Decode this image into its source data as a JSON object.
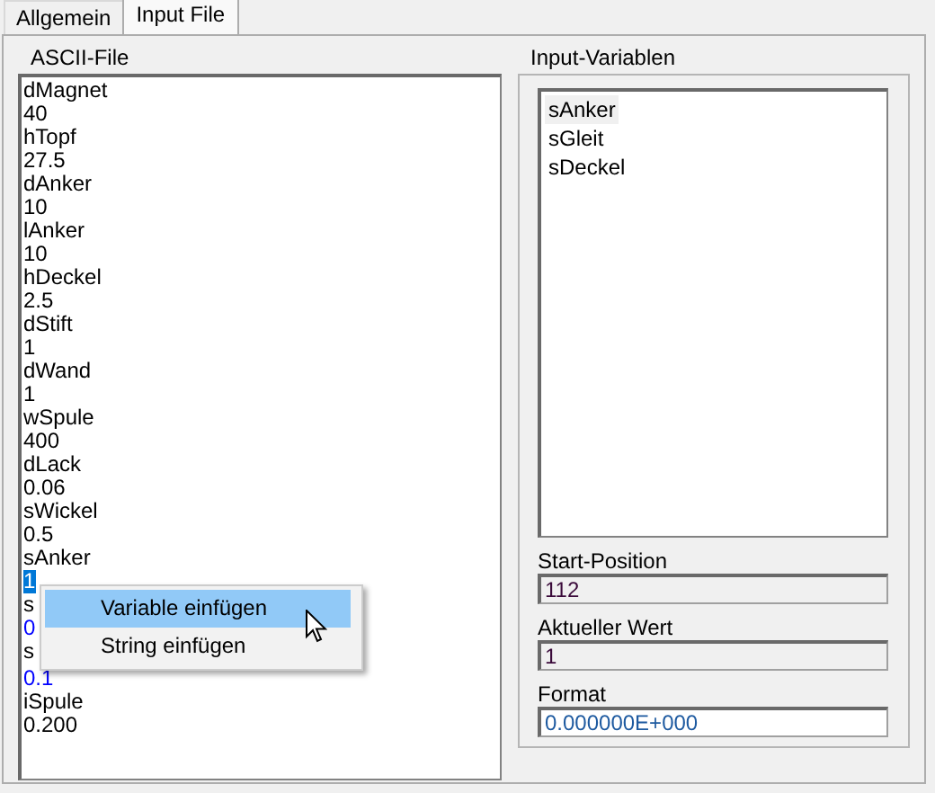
{
  "tabs": [
    {
      "label": "Allgemein",
      "selected": false
    },
    {
      "label": "Input File",
      "selected": true
    }
  ],
  "ascii_file": {
    "label": "ASCII-File",
    "lines": [
      {
        "text": "dMagnet",
        "kind": "plain"
      },
      {
        "text": "40",
        "kind": "plain"
      },
      {
        "text": "hTopf",
        "kind": "plain"
      },
      {
        "text": "27.5",
        "kind": "plain"
      },
      {
        "text": "dAnker",
        "kind": "plain"
      },
      {
        "text": "10",
        "kind": "plain"
      },
      {
        "text": "lAnker",
        "kind": "plain"
      },
      {
        "text": "10",
        "kind": "plain"
      },
      {
        "text": "hDeckel",
        "kind": "plain"
      },
      {
        "text": "2.5",
        "kind": "plain"
      },
      {
        "text": "dStift",
        "kind": "plain"
      },
      {
        "text": "1",
        "kind": "plain"
      },
      {
        "text": "dWand",
        "kind": "plain"
      },
      {
        "text": "1",
        "kind": "plain"
      },
      {
        "text": "wSpule",
        "kind": "plain"
      },
      {
        "text": "400",
        "kind": "plain"
      },
      {
        "text": "dLack",
        "kind": "plain"
      },
      {
        "text": "0.06",
        "kind": "plain"
      },
      {
        "text": "sWickel",
        "kind": "plain"
      },
      {
        "text": "0.5",
        "kind": "plain"
      },
      {
        "text": "sAnker",
        "kind": "plain"
      },
      {
        "text": "1",
        "kind": "selected"
      },
      {
        "text": "s",
        "kind": "plain"
      },
      {
        "text": "0",
        "kind": "variable"
      },
      {
        "text": "s",
        "kind": "plain"
      },
      {
        "text": "0.1",
        "kind": "variable"
      },
      {
        "text": "iSpule",
        "kind": "plain"
      },
      {
        "text": "0.200",
        "kind": "plain"
      }
    ]
  },
  "input_variables": {
    "label": "Input-Variablen",
    "items": [
      {
        "text": "sAnker",
        "selected": true
      },
      {
        "text": "sGleit",
        "selected": false
      },
      {
        "text": "sDeckel",
        "selected": false
      }
    ],
    "fields": [
      {
        "label": "Start-Position",
        "value": "112",
        "disabled": true
      },
      {
        "label": "Aktueller Wert",
        "value": "1",
        "disabled": true
      },
      {
        "label": "Format",
        "value": "0.000000E+000",
        "disabled": false
      }
    ]
  },
  "context_menu": {
    "items": [
      {
        "label": "Variable einfügen",
        "selected": true
      },
      {
        "label": "String einfügen",
        "selected": false
      }
    ]
  }
}
